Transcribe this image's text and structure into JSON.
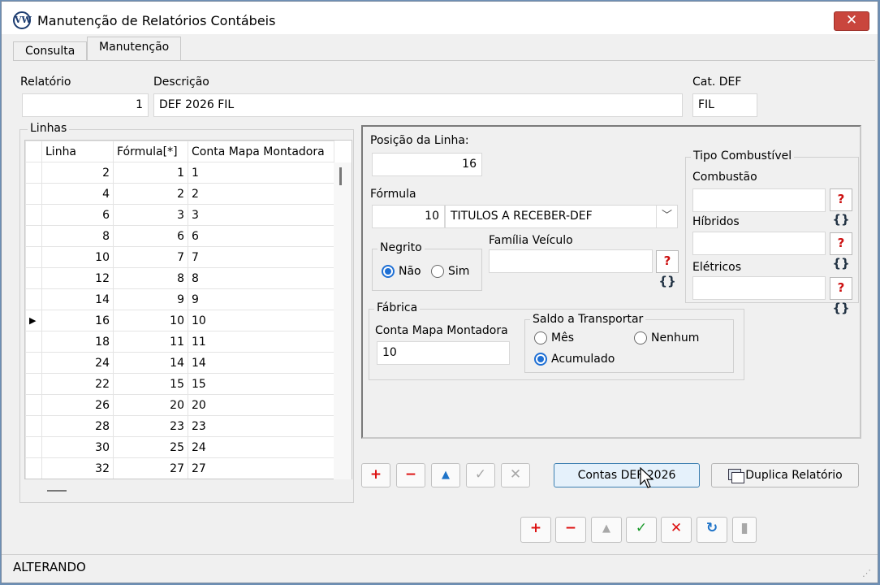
{
  "window": {
    "title": "Manutenção de Relatórios Contábeis",
    "close_label": "✕"
  },
  "tabs": [
    {
      "label": "Consulta"
    },
    {
      "label": "Manutenção"
    }
  ],
  "header": {
    "relatorio_label": "Relatório",
    "relatorio_value": "1",
    "descricao_label": "Descrição",
    "descricao_value": "DEF 2026 FIL",
    "catdef_label": "Cat. DEF",
    "catdef_value": "FIL"
  },
  "linhas": {
    "title": "Linhas",
    "columns": [
      "Linha",
      "Fórmula[*]",
      "Conta Mapa Montadora"
    ],
    "current_row": 7,
    "rows": [
      [
        "2",
        "1",
        "1"
      ],
      [
        "4",
        "2",
        "2"
      ],
      [
        "6",
        "3",
        "3"
      ],
      [
        "8",
        "6",
        "6"
      ],
      [
        "10",
        "7",
        "7"
      ],
      [
        "12",
        "8",
        "8"
      ],
      [
        "14",
        "9",
        "9"
      ],
      [
        "16",
        "10",
        "10"
      ],
      [
        "18",
        "11",
        "11"
      ],
      [
        "24",
        "14",
        "14"
      ],
      [
        "22",
        "15",
        "15"
      ],
      [
        "26",
        "20",
        "20"
      ],
      [
        "28",
        "23",
        "23"
      ],
      [
        "30",
        "25",
        "24"
      ],
      [
        "32",
        "27",
        "27"
      ]
    ]
  },
  "form": {
    "posicao_label": "Posição da Linha:",
    "posicao_value": "16",
    "formula_label": "Fórmula",
    "formula_code": "10",
    "formula_desc": "TITULOS A RECEBER-DEF",
    "negrito_title": "Negrito",
    "negrito_nao": "Não",
    "negrito_sim": "Sim",
    "familia_label": "Família Veículo",
    "familia_value": "",
    "tipo_title": "Tipo Combustível",
    "combustao_label": "Combustão",
    "hibridos_label": "Híbridos",
    "eletricos_label": "Elétricos",
    "fabrica_title": "Fábrica",
    "conta_label": "Conta Mapa Montadora",
    "conta_value": "10",
    "saldo_title": "Saldo a Transportar",
    "saldo_mes": "Mês",
    "saldo_nenhum": "Nenhum",
    "saldo_acumulado": "Acumulado"
  },
  "buttons": {
    "contas_def": "Contas DEF 2026",
    "duplica": "Duplica Relatório"
  },
  "status": {
    "text": "ALTERANDO"
  }
}
